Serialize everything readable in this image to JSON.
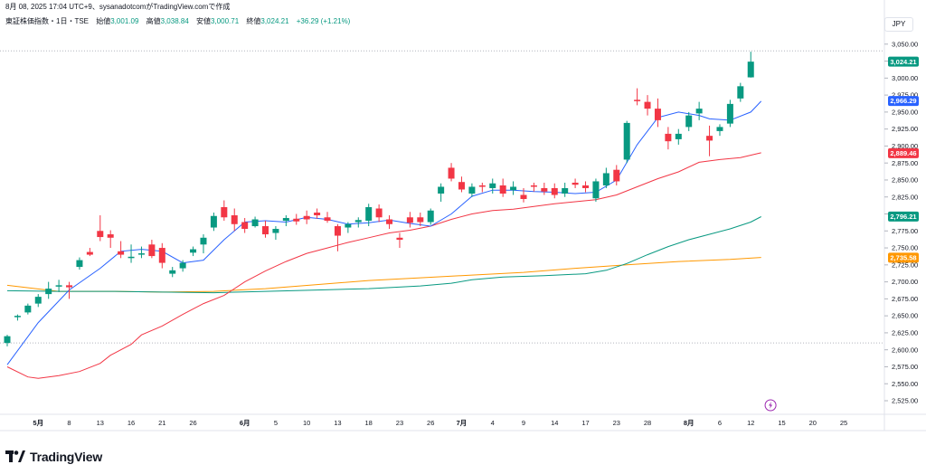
{
  "header": {
    "caption": "8月 08, 2025 17:04 UTC+9、sysanadotcomがTradingView.comで作成",
    "symbol": "東証株価指数・1日・TSE",
    "open_label": "始値",
    "open": "3,001.09",
    "high_label": "高値",
    "high": "3,038.84",
    "low_label": "安値",
    "low": "3,000.71",
    "close_label": "終値",
    "close": "3,024.21",
    "change": "+36.29 (+1.21%)"
  },
  "currency": "JPY",
  "brand": "TradingView",
  "colors": {
    "up": "#089981",
    "down": "#f23645",
    "ma_blue": "#2962ff",
    "ma_red": "#f23645",
    "ma_green": "#089981",
    "ma_orange": "#ff9800",
    "grid_dotted": "#b2b5be"
  },
  "chart_data": {
    "type": "candlestick",
    "y_range": [
      2510,
      3065
    ],
    "y_ticks": [
      2525,
      2550,
      2575,
      2600,
      2625,
      2650,
      2675,
      2700,
      2725,
      2750,
      2775,
      2800,
      2825,
      2850,
      2875,
      2900,
      2925,
      2950,
      2975,
      3000,
      3025,
      3050
    ],
    "y_tick_labels": [
      "2,525.00",
      "2,550.00",
      "2,575.00",
      "2,600.00",
      "2,625.00",
      "2,650.00",
      "2,675.00",
      "2,700.00",
      "2,725.00",
      "2,750.00",
      "2,775.00",
      "2,800.00",
      "2,825.00",
      "2,850.00",
      "2,875.00",
      "2,900.00",
      "2,925.00",
      "2,950.00",
      "2,975.00",
      "3,000.00",
      "3,025.00",
      "3,050.00"
    ],
    "x_labels": [
      {
        "i": 3,
        "label": "5月",
        "bold": true
      },
      {
        "i": 6,
        "label": "8"
      },
      {
        "i": 9,
        "label": "13"
      },
      {
        "i": 12,
        "label": "16"
      },
      {
        "i": 15,
        "label": "21"
      },
      {
        "i": 18,
        "label": "26"
      },
      {
        "i": 23,
        "label": "6月",
        "bold": true
      },
      {
        "i": 26,
        "label": "5"
      },
      {
        "i": 29,
        "label": "10"
      },
      {
        "i": 32,
        "label": "13"
      },
      {
        "i": 35,
        "label": "18"
      },
      {
        "i": 38,
        "label": "23"
      },
      {
        "i": 41,
        "label": "26"
      },
      {
        "i": 44,
        "label": "7月",
        "bold": true
      },
      {
        "i": 47,
        "label": "4"
      },
      {
        "i": 50,
        "label": "9"
      },
      {
        "i": 53,
        "label": "14"
      },
      {
        "i": 56,
        "label": "17"
      },
      {
        "i": 59,
        "label": "23"
      },
      {
        "i": 62,
        "label": "28"
      },
      {
        "i": 66,
        "label": "8月",
        "bold": true
      },
      {
        "i": 69,
        "label": "6"
      },
      {
        "i": 72,
        "label": "12"
      },
      {
        "i": 75,
        "label": "15"
      },
      {
        "i": 78,
        "label": "20"
      },
      {
        "i": 81,
        "label": "25"
      }
    ],
    "candles": [
      [
        2610,
        2622,
        2605,
        2620
      ],
      [
        2648,
        2652,
        2643,
        2650
      ],
      [
        2655,
        2668,
        2652,
        2665
      ],
      [
        2668,
        2682,
        2663,
        2678
      ],
      [
        2682,
        2700,
        2675,
        2690
      ],
      [
        2693,
        2703,
        2685,
        2695
      ],
      [
        2695,
        2700,
        2675,
        2692
      ],
      [
        2722,
        2736,
        2718,
        2732
      ],
      [
        2744,
        2750,
        2738,
        2740
      ],
      [
        2775,
        2798,
        2760,
        2766
      ],
      [
        2770,
        2776,
        2750,
        2765
      ],
      [
        2745,
        2760,
        2735,
        2740
      ],
      [
        2735,
        2755,
        2728,
        2737
      ],
      [
        2740,
        2752,
        2735,
        2742
      ],
      [
        2755,
        2762,
        2735,
        2738
      ],
      [
        2750,
        2757,
        2720,
        2728
      ],
      [
        2712,
        2722,
        2707,
        2717
      ],
      [
        2720,
        2732,
        2715,
        2728
      ],
      [
        2743,
        2752,
        2738,
        2748
      ],
      [
        2755,
        2770,
        2742,
        2765
      ],
      [
        2780,
        2802,
        2775,
        2797
      ],
      [
        2810,
        2820,
        2790,
        2795
      ],
      [
        2798,
        2808,
        2775,
        2785
      ],
      [
        2788,
        2794,
        2772,
        2778
      ],
      [
        2782,
        2796,
        2780,
        2792
      ],
      [
        2782,
        2790,
        2765,
        2770
      ],
      [
        2772,
        2782,
        2762,
        2778
      ],
      [
        2790,
        2798,
        2782,
        2794
      ],
      [
        2793,
        2800,
        2784,
        2789
      ],
      [
        2797,
        2805,
        2785,
        2792
      ],
      [
        2802,
        2808,
        2793,
        2798
      ],
      [
        2795,
        2803,
        2787,
        2790
      ],
      [
        2782,
        2785,
        2745,
        2768
      ],
      [
        2780,
        2788,
        2772,
        2785
      ],
      [
        2788,
        2795,
        2780,
        2791
      ],
      [
        2790,
        2815,
        2782,
        2810
      ],
      [
        2808,
        2814,
        2788,
        2795
      ],
      [
        2792,
        2798,
        2778,
        2785
      ],
      [
        2765,
        2772,
        2750,
        2762
      ],
      [
        2795,
        2803,
        2780,
        2787
      ],
      [
        2795,
        2802,
        2782,
        2788
      ],
      [
        2788,
        2808,
        2784,
        2805
      ],
      [
        2830,
        2845,
        2818,
        2840
      ],
      [
        2868,
        2875,
        2848,
        2852
      ],
      [
        2847,
        2855,
        2832,
        2836
      ],
      [
        2830,
        2845,
        2825,
        2840
      ],
      [
        2842,
        2846,
        2832,
        2840
      ],
      [
        2838,
        2852,
        2830,
        2845
      ],
      [
        2842,
        2852,
        2825,
        2830
      ],
      [
        2835,
        2848,
        2828,
        2840
      ],
      [
        2828,
        2838,
        2817,
        2822
      ],
      [
        2842,
        2846,
        2833,
        2840
      ],
      [
        2838,
        2846,
        2828,
        2833
      ],
      [
        2838,
        2845,
        2823,
        2828
      ],
      [
        2830,
        2846,
        2825,
        2838
      ],
      [
        2846,
        2852,
        2838,
        2843
      ],
      [
        2842,
        2848,
        2832,
        2838
      ],
      [
        2823,
        2852,
        2818,
        2848
      ],
      [
        2842,
        2868,
        2838,
        2860
      ],
      [
        2865,
        2872,
        2842,
        2848
      ],
      [
        2880,
        2937,
        2875,
        2934
      ],
      [
        2968,
        2985,
        2960,
        2966
      ],
      [
        2965,
        2975,
        2945,
        2955
      ],
      [
        2955,
        2970,
        2928,
        2938
      ],
      [
        2918,
        2928,
        2895,
        2907
      ],
      [
        2910,
        2925,
        2902,
        2918
      ],
      [
        2928,
        2950,
        2922,
        2945
      ],
      [
        2948,
        2965,
        2938,
        2955
      ],
      [
        2915,
        2930,
        2885,
        2908
      ],
      [
        2922,
        2932,
        2915,
        2928
      ],
      [
        2933,
        2968,
        2928,
        2962
      ],
      [
        2970,
        2993,
        2965,
        2988
      ],
      [
        3001.09,
        3038.84,
        3000.71,
        3024.21
      ]
    ],
    "ma_blue": [
      [
        0,
        2578
      ],
      [
        3,
        2640
      ],
      [
        6,
        2688
      ],
      [
        9,
        2720
      ],
      [
        11,
        2745
      ],
      [
        13,
        2748
      ],
      [
        15,
        2745
      ],
      [
        17,
        2728
      ],
      [
        19,
        2732
      ],
      [
        21,
        2762
      ],
      [
        23,
        2788
      ],
      [
        25,
        2790
      ],
      [
        27,
        2788
      ],
      [
        29,
        2795
      ],
      [
        31,
        2792
      ],
      [
        33,
        2785
      ],
      [
        35,
        2787
      ],
      [
        37,
        2791
      ],
      [
        39,
        2786
      ],
      [
        41,
        2782
      ],
      [
        43,
        2800
      ],
      [
        45,
        2826
      ],
      [
        47,
        2835
      ],
      [
        49,
        2835
      ],
      [
        51,
        2833
      ],
      [
        53,
        2832
      ],
      [
        55,
        2830
      ],
      [
        57,
        2832
      ],
      [
        59,
        2850
      ],
      [
        61,
        2902
      ],
      [
        63,
        2942
      ],
      [
        65,
        2950
      ],
      [
        67,
        2945
      ],
      [
        68,
        2940
      ],
      [
        70,
        2938
      ],
      [
        72,
        2950
      ],
      [
        73,
        2966
      ]
    ],
    "ma_red": [
      [
        0,
        2575
      ],
      [
        2,
        2560
      ],
      [
        3,
        2558
      ],
      [
        5,
        2562
      ],
      [
        7,
        2568
      ],
      [
        9,
        2580
      ],
      [
        10,
        2592
      ],
      [
        12,
        2608
      ],
      [
        13,
        2622
      ],
      [
        15,
        2635
      ],
      [
        17,
        2652
      ],
      [
        19,
        2668
      ],
      [
        21,
        2680
      ],
      [
        23,
        2700
      ],
      [
        25,
        2716
      ],
      [
        27,
        2730
      ],
      [
        29,
        2742
      ],
      [
        31,
        2750
      ],
      [
        33,
        2758
      ],
      [
        35,
        2765
      ],
      [
        37,
        2772
      ],
      [
        39,
        2776
      ],
      [
        41,
        2782
      ],
      [
        43,
        2792
      ],
      [
        45,
        2800
      ],
      [
        47,
        2805
      ],
      [
        49,
        2807
      ],
      [
        51,
        2811
      ],
      [
        53,
        2815
      ],
      [
        55,
        2818
      ],
      [
        57,
        2821
      ],
      [
        59,
        2828
      ],
      [
        61,
        2840
      ],
      [
        63,
        2852
      ],
      [
        65,
        2862
      ],
      [
        67,
        2876
      ],
      [
        69,
        2880
      ],
      [
        71,
        2883
      ],
      [
        73,
        2890
      ]
    ],
    "ma_green": [
      [
        0,
        2687
      ],
      [
        5,
        2686
      ],
      [
        10,
        2686
      ],
      [
        15,
        2685
      ],
      [
        20,
        2684
      ],
      [
        25,
        2686
      ],
      [
        30,
        2688
      ],
      [
        35,
        2690
      ],
      [
        40,
        2694
      ],
      [
        43,
        2698
      ],
      [
        45,
        2703
      ],
      [
        48,
        2707
      ],
      [
        52,
        2709
      ],
      [
        56,
        2712
      ],
      [
        58,
        2717
      ],
      [
        60,
        2727
      ],
      [
        62,
        2740
      ],
      [
        64,
        2752
      ],
      [
        66,
        2762
      ],
      [
        68,
        2770
      ],
      [
        70,
        2778
      ],
      [
        72,
        2788
      ],
      [
        73,
        2796
      ]
    ],
    "ma_orange": [
      [
        0,
        2695
      ],
      [
        5,
        2686
      ],
      [
        10,
        2686
      ],
      [
        15,
        2685
      ],
      [
        20,
        2686
      ],
      [
        25,
        2690
      ],
      [
        30,
        2696
      ],
      [
        35,
        2702
      ],
      [
        40,
        2706
      ],
      [
        45,
        2710
      ],
      [
        50,
        2714
      ],
      [
        55,
        2720
      ],
      [
        60,
        2725
      ],
      [
        65,
        2730
      ],
      [
        70,
        2733
      ],
      [
        73,
        2736
      ]
    ],
    "price_tags": [
      {
        "value": 3024.21,
        "label": "3,024.21",
        "color": "#089981"
      },
      {
        "value": 2966.29,
        "label": "2,966.29",
        "color": "#2962ff"
      },
      {
        "value": 2889.46,
        "label": "2,889.46",
        "color": "#f23645"
      },
      {
        "value": 2796.21,
        "label": "2,796.21",
        "color": "#089981"
      },
      {
        "value": 2735.58,
        "label": "2,735.58",
        "color": "#ff9800"
      }
    ],
    "dotted_lines": [
      3040,
      2610
    ]
  }
}
